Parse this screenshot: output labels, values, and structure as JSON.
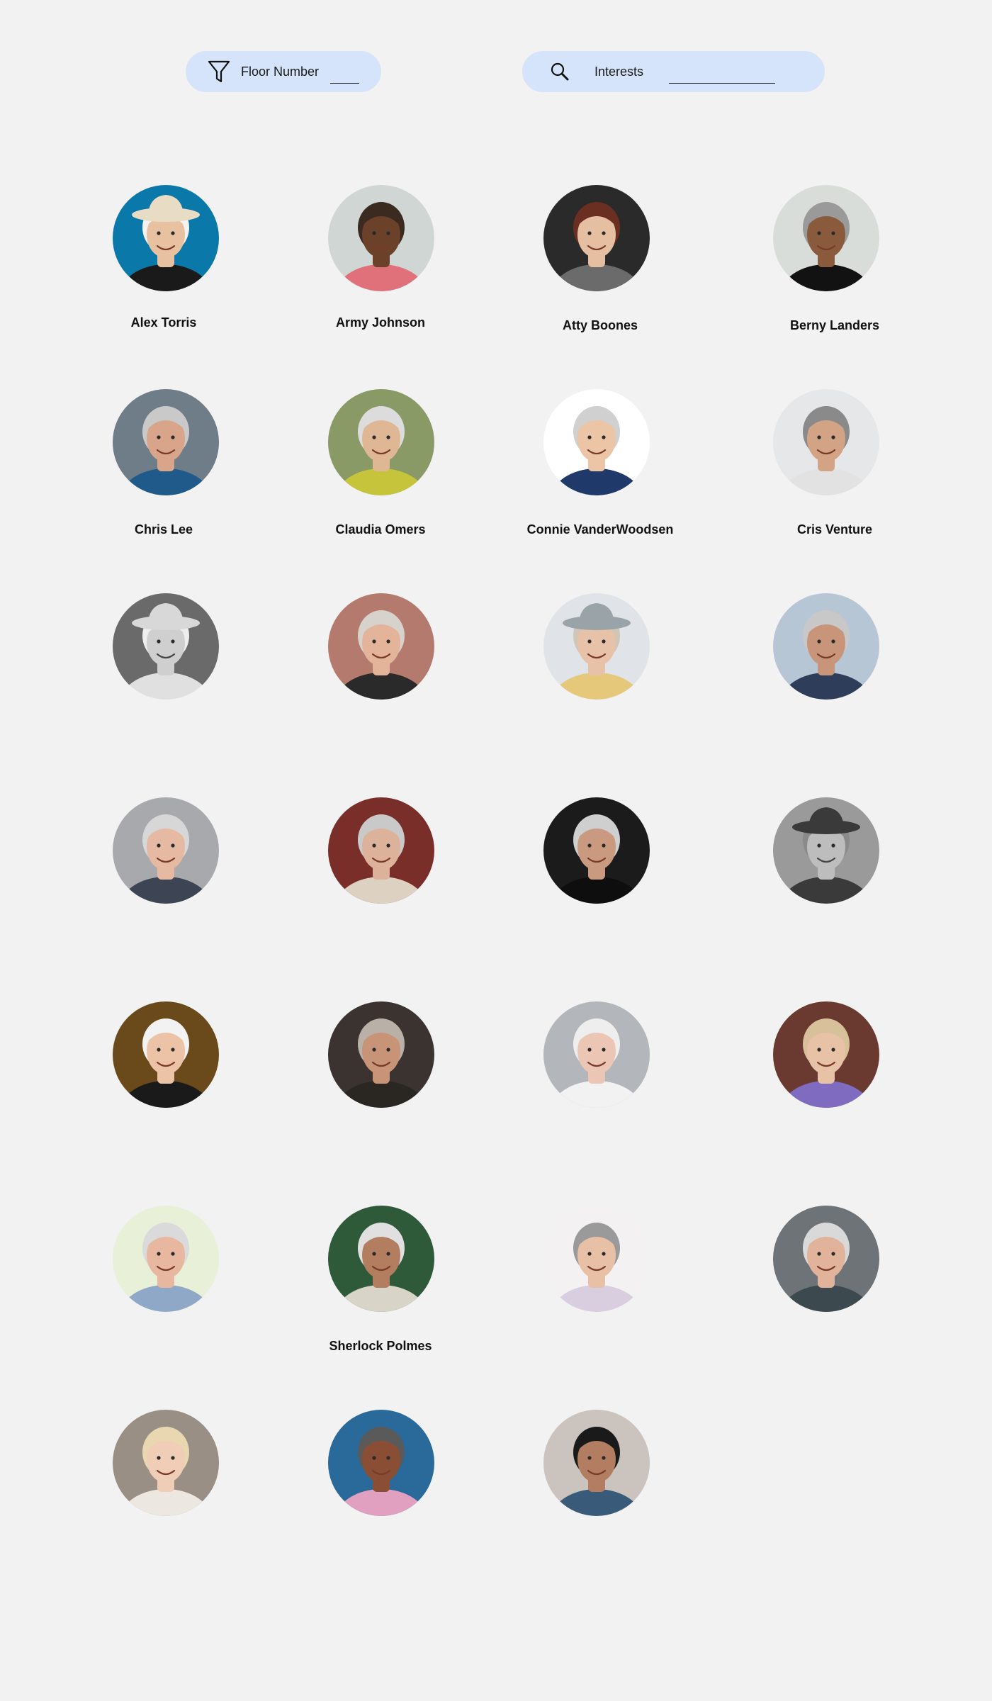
{
  "filters": {
    "floor": {
      "icon": "filter-icon",
      "label": "Floor Number",
      "value": ""
    },
    "interests": {
      "icon": "search-icon",
      "label": "Interests",
      "value": ""
    }
  },
  "residents": [
    {
      "name": "Alex Torris",
      "bg": "#0a78a8",
      "skin": "#e8c2a0",
      "hair": "#f2f2f2",
      "shirt": "#1a1a1a",
      "hat": "#e8dcc4"
    },
    {
      "name": "Army Johnson",
      "bg": "#cfd6d3",
      "skin": "#6b4129",
      "hair": "#3a2a20",
      "shirt": "#e0707a"
    },
    {
      "name": "Atty Boones",
      "bg": "#2a2a2a",
      "skin": "#e6bfa3",
      "hair": "#6b2f22",
      "shirt": "#6b6b6b"
    },
    {
      "name": "Berny Landers",
      "bg": "#d9ddd9",
      "skin": "#8a5a3c",
      "hair": "#9a9a9a",
      "shirt": "#121212"
    },
    {
      "name": "Chris Lee",
      "bg": "#6f7d89",
      "skin": "#d9a58a",
      "hair": "#c9c9c9",
      "shirt": "#1f5a8a"
    },
    {
      "name": "Claudia Omers",
      "bg": "#8a9a66",
      "skin": "#e0b795",
      "hair": "#dcdcdc",
      "shirt": "#c6c43a"
    },
    {
      "name": "Connie VanderWoodsen",
      "bg": "#ffffff",
      "skin": "#ecc4a6",
      "hair": "#d0d0d0",
      "shirt": "#1f3a6a"
    },
    {
      "name": "Cris Venture",
      "bg": "#e6e7e9",
      "skin": "#d2a385",
      "hair": "#8a8a8a",
      "shirt": "#e2e2e2"
    },
    {
      "name": "",
      "bg": "#6a6a6a",
      "skin": "#cfcfcf",
      "hair": "#eeeeee",
      "shirt": "#e0e0e0",
      "hat": "#d8d8d8",
      "bw": true
    },
    {
      "name": "",
      "bg": "#b57a6e",
      "skin": "#e4b49a",
      "hair": "#d8d2cc",
      "shirt": "#2a2a2a"
    },
    {
      "name": "",
      "bg": "#e0e4e8",
      "skin": "#e8c2a8",
      "hair": "#cfc6b8",
      "shirt": "#e6c87a",
      "hat": "#9aa4a8"
    },
    {
      "name": "",
      "bg": "#b7c6d4",
      "skin": "#c8957a",
      "hair": "#c8c8c8",
      "shirt": "#2e3e5a"
    },
    {
      "name": "",
      "bg": "#a7a9ad",
      "skin": "#e6b9a3",
      "hair": "#d7d7d7",
      "shirt": "#3d4454"
    },
    {
      "name": "",
      "bg": "#7a2e2a",
      "skin": "#dcb29a",
      "hair": "#c9c9c9",
      "shirt": "#ddd1c2"
    },
    {
      "name": "",
      "bg": "#1b1b1b",
      "skin": "#c99a80",
      "hair": "#cfcfcf",
      "shirt": "#0e0e0e"
    },
    {
      "name": "",
      "bg": "#9a9a9a",
      "skin": "#bdbdbd",
      "hair": "#8a8a8a",
      "shirt": "#3a3a3a",
      "hat": "#3a3a3a",
      "bw": true
    },
    {
      "name": "",
      "bg": "#6a4a1a",
      "skin": "#ecc3a7",
      "hair": "#f2f2f2",
      "shirt": "#1a1a1a"
    },
    {
      "name": "",
      "bg": "#3a3330",
      "skin": "#c89478",
      "hair": "#b9b1a8",
      "shirt": "#2a2622"
    },
    {
      "name": "",
      "bg": "#b3b6ba",
      "skin": "#ecc6b4",
      "hair": "#eeeeee",
      "shirt": "#f2f2f2"
    },
    {
      "name": "",
      "bg": "#6a3a30",
      "skin": "#e8c2a6",
      "hair": "#d8c09a",
      "shirt": "#7f6cc0"
    },
    {
      "name": "",
      "bg": "#e8f0d8",
      "skin": "#e8b79f",
      "hair": "#dadada",
      "shirt": "#8fa8c8"
    },
    {
      "name": "Sherlock Polmes",
      "bg": "#2f5a3a",
      "skin": "#b27e5f",
      "hair": "#e0e0e0",
      "shirt": "#d9d4c8"
    },
    {
      "name": "",
      "bg": "#f3f1f2",
      "skin": "#e8c0a6",
      "hair": "#9a9a9a",
      "shirt": "#d9cde0"
    },
    {
      "name": "",
      "bg": "#6d7377",
      "skin": "#e0b39a",
      "hair": "#d9d9d9",
      "shirt": "#3c4a4f"
    },
    {
      "name": "",
      "bg": "#9a8f85",
      "skin": "#f0cdb6",
      "hair": "#e8d7b0",
      "shirt": "#ece7e0"
    },
    {
      "name": "",
      "bg": "#2a6a9a",
      "skin": "#8a4e34",
      "hair": "#5a5a5a",
      "shirt": "#e2a0c0"
    },
    {
      "name": "",
      "bg": "#cbc3bd",
      "skin": "#b27d60",
      "hair": "#1a1a1a",
      "shirt": "#3a5a7a"
    }
  ]
}
